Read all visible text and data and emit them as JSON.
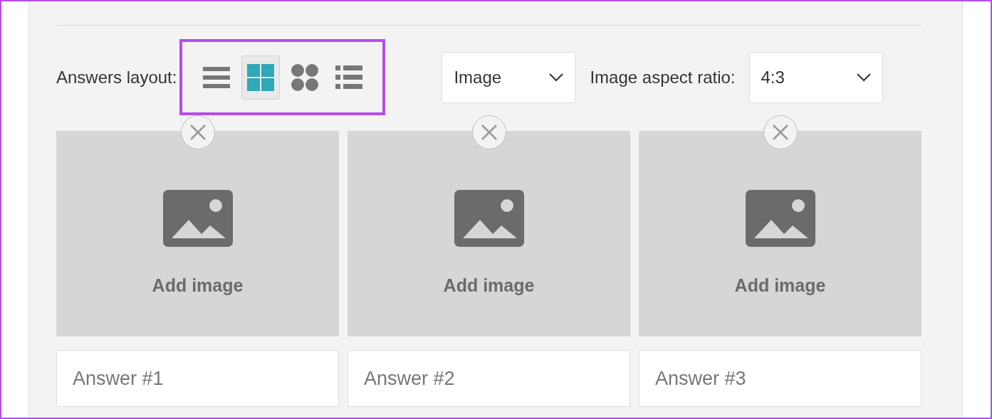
{
  "answers_layout": {
    "label": "Answers layout:",
    "options": [
      {
        "kind": "rows",
        "selected": false
      },
      {
        "kind": "grid",
        "selected": true
      },
      {
        "kind": "dots",
        "selected": false
      },
      {
        "kind": "list",
        "selected": false
      }
    ]
  },
  "answer_type": {
    "value": "Image"
  },
  "aspect_ratio": {
    "label": "Image aspect ratio:",
    "value": "4:3"
  },
  "answers": [
    {
      "image_label": "Add image",
      "placeholder": "Answer #1"
    },
    {
      "image_label": "Add image",
      "placeholder": "Answer #2"
    },
    {
      "image_label": "Add image",
      "placeholder": "Answer #3"
    }
  ]
}
